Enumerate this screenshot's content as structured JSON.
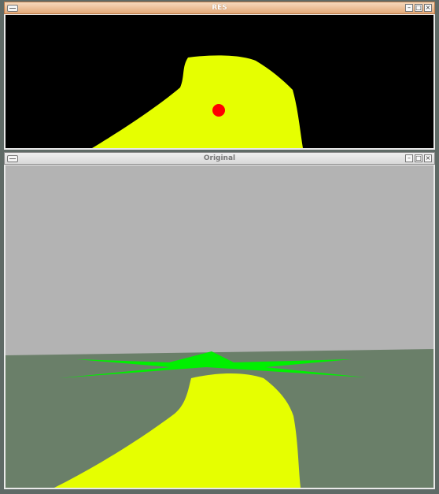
{
  "windows": {
    "res": {
      "title": "RES"
    },
    "original": {
      "title": "Original"
    }
  },
  "controls": {
    "minimize": "–",
    "maximize": "□",
    "close": "×"
  },
  "colors": {
    "track_yellow": "#e6ff00",
    "marker_red": "#ff0000",
    "star_green": "#00f000",
    "sky_gray": "#b3b3b3",
    "ground_green": "#6a7f69",
    "res_background": "#000000"
  },
  "icons": [
    "window-menu-icon",
    "minimize-icon",
    "maximize-icon",
    "close-icon"
  ]
}
